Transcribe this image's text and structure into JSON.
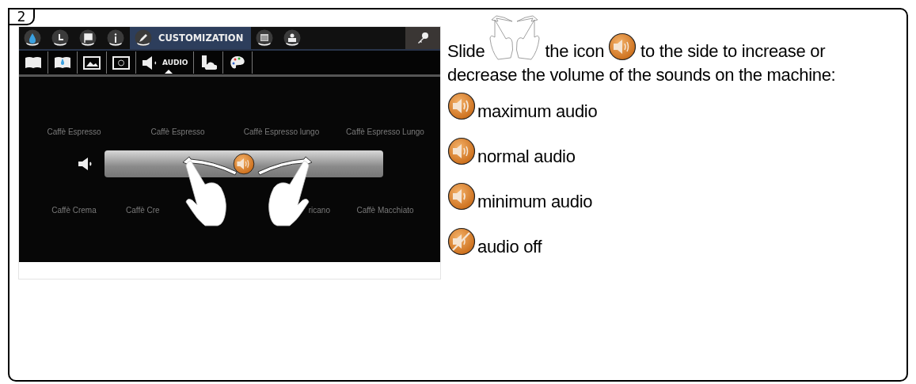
{
  "badge": "2",
  "screen": {
    "nav_tabs": [
      {
        "kind": "drop",
        "selected": false
      },
      {
        "kind": "clock",
        "selected": false
      },
      {
        "kind": "flag",
        "selected": false
      },
      {
        "kind": "info",
        "selected": false
      },
      {
        "kind": "pencil",
        "label": "CUSTOMIZATION",
        "selected": true
      },
      {
        "kind": "calendar",
        "selected": false
      },
      {
        "kind": "person",
        "selected": false
      }
    ],
    "sub_tabs": [
      {
        "kind": "book",
        "selected": false
      },
      {
        "kind": "book-drop",
        "selected": false
      },
      {
        "kind": "picture",
        "selected": false
      },
      {
        "kind": "screensaver",
        "selected": false
      },
      {
        "kind": "speaker",
        "label": "AUDIO",
        "selected": true
      },
      {
        "kind": "usb-cloud",
        "selected": false
      },
      {
        "kind": "palette",
        "selected": false
      }
    ],
    "products_top": [
      "Caffè Espresso",
      "Caffè Espresso",
      "Caffè Espresso lungo",
      "Caffè Espresso Lungo"
    ],
    "products_bottom": [
      "Caffè Crema",
      "Caffè Cre",
      "ricano",
      "Caffè Macchiato"
    ],
    "volume": {
      "level": 0.5
    }
  },
  "intro": {
    "line_1": [
      "Slide",
      "the icon",
      "to the side to increase or"
    ],
    "line_2": "decrease the volume of the sounds on the machine:"
  },
  "legend": [
    {
      "kind": "max",
      "label": "maximum audio"
    },
    {
      "kind": "normal",
      "label": "normal audio"
    },
    {
      "kind": "min",
      "label": "minimum audio"
    },
    {
      "kind": "off",
      "label": "audio off"
    }
  ]
}
